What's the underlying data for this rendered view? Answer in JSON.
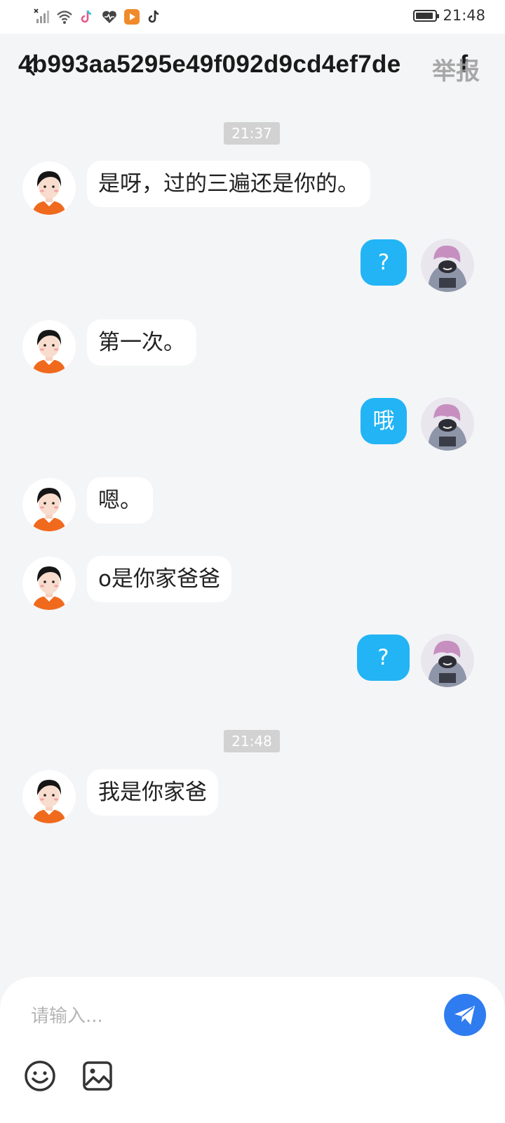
{
  "status": {
    "time": "21:48",
    "battery_level": 0.9
  },
  "header": {
    "title": "4b993aa5295e49f092d9cd4ef7de",
    "title_suffix": "f",
    "report": "举报"
  },
  "messages": [
    {
      "type": "time",
      "text": "21:37"
    },
    {
      "type": "in",
      "text": "是呀，过的三遍还是你的。"
    },
    {
      "type": "out",
      "text": "?"
    },
    {
      "type": "in",
      "text": "第一次。"
    },
    {
      "type": "out",
      "text": "哦"
    },
    {
      "type": "in",
      "text": "嗯。"
    },
    {
      "type": "in",
      "text": "o是你家爸爸"
    },
    {
      "type": "out",
      "text": "?"
    },
    {
      "type": "time",
      "text": "21:48"
    },
    {
      "type": "in",
      "text": "我是你家爸"
    }
  ],
  "composer": {
    "placeholder": "请输入..."
  },
  "colors": {
    "accent": "#22b4f5",
    "send": "#2f7cf0",
    "background": "#f4f5f7"
  },
  "icons": [
    "signal-icon",
    "wifi-icon",
    "tiktok-icon",
    "health-icon",
    "video-app-icon",
    "battery-icon",
    "back-icon",
    "send-icon",
    "emoji-icon",
    "image-icon"
  ]
}
